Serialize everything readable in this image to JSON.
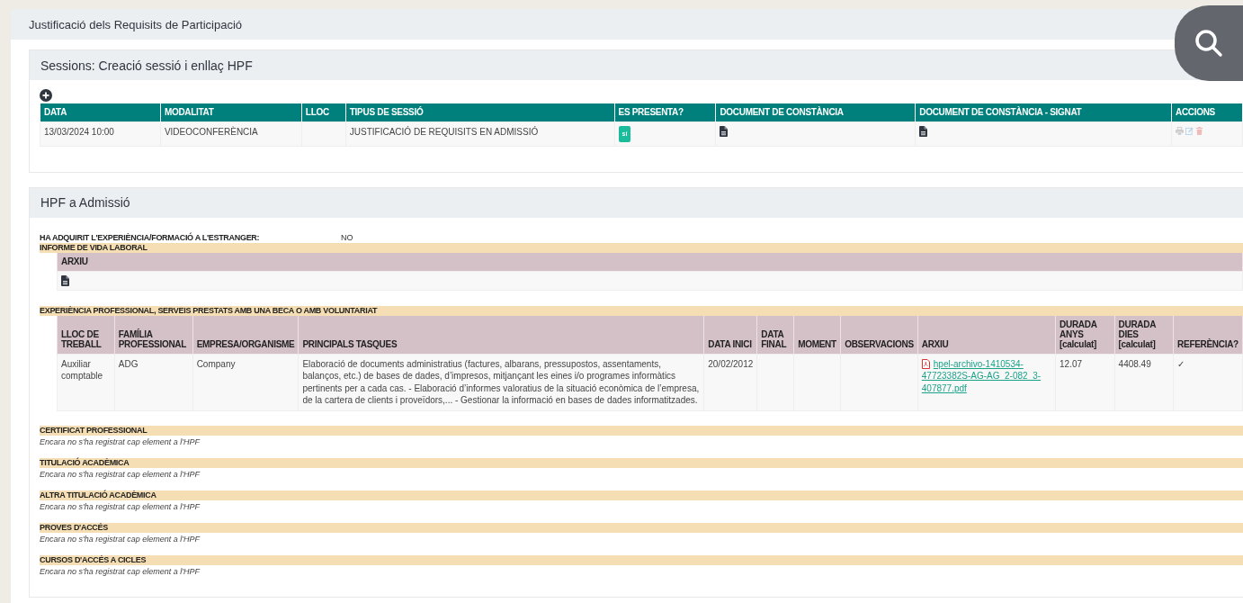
{
  "page_title": "Justificació dels Requisits de Participació",
  "sessions": {
    "title": "Sessions: Creació sessió i enllaç HPF",
    "columns": [
      "DATA",
      "MODALITAT",
      "LLOC",
      "TIPUS DE SESSIÓ",
      "ES PRESENTA?",
      "DOCUMENT DE CONSTÀNCIA",
      "DOCUMENT DE CONSTÀNCIA - SIGNAT",
      "ACCIONS"
    ],
    "rows": [
      {
        "cells": [
          {
            "kind": "text",
            "text": "13/03/2024 10:00"
          },
          {
            "kind": "text",
            "text": "VIDEOCONFERÈNCIA"
          },
          {
            "kind": "empty"
          },
          {
            "kind": "text",
            "text": "JUSTIFICACIÓ DE REQUISITS EN ADMISSIÓ"
          },
          {
            "kind": "badge",
            "text": "sí"
          },
          {
            "kind": "document"
          },
          {
            "kind": "document"
          },
          {
            "kind": "actions",
            "disabled": true
          }
        ]
      }
    ]
  },
  "hpf": {
    "title": "HPF a Admissió",
    "fields": [
      {
        "label": "HA ADQUIRIT L'EXPERIÈNCIA/FORMACIÓ A L'ESTRANGER:",
        "value": "NO"
      }
    ],
    "sections": [
      {
        "kind": "files",
        "title": "INFORME DE VIDA LABORAL",
        "columns": [
          "ARXIU"
        ],
        "rows": [
          {
            "cells": [
              {
                "kind": "document"
              }
            ]
          }
        ]
      },
      {
        "kind": "table",
        "title": "EXPERIÈNCIA PROFESSIONAL, SERVEIS PRESTATS AMB UNA BECA O AMB VOLUNTARIAT",
        "columns": [
          "LLOC DE TREBALL",
          "FAMÍLIA PROFESSIONAL",
          "EMPRESA/ORGANISME",
          "PRINCIPALS TASQUES",
          "DATA INICI",
          "DATA FINAL",
          "MOMENT",
          "OBSERVACIONS",
          "ARXIU",
          "DURADA ANYS [calculat]",
          "DURADA DIES [calculat]",
          "REFERÈNCIA?"
        ],
        "rows": [
          {
            "cells": [
              {
                "kind": "text",
                "text": "Auxiliar comptable"
              },
              {
                "kind": "text",
                "text": "ADG"
              },
              {
                "kind": "text",
                "text": "Company"
              },
              {
                "kind": "text",
                "text": "Elaboració de documents administratius (factures, albarans, pressupostos, assentaments, balanços, etc.) de bases de dades, d’impresos, mitjançant les eines i/o programes informàtics pertinents per a cada cas. - Elaboració d’informes valoratius de la situació econòmica de l’empresa, de la cartera de clients i proveïdors,... - Gestionar la informació en bases de dades informatitzades."
              },
              {
                "kind": "text",
                "text": "20/02/2012"
              },
              {
                "kind": "empty"
              },
              {
                "kind": "empty"
              },
              {
                "kind": "empty"
              },
              {
                "kind": "file",
                "text": "hpel-archivo-1410534-47723382S-AG-AG_2-082_3-407877.pdf"
              },
              {
                "kind": "text",
                "text": "12.07"
              },
              {
                "kind": "text",
                "text": "4408.49"
              },
              {
                "kind": "text",
                "text": "✓"
              }
            ]
          }
        ]
      },
      {
        "kind": "message",
        "title": "CERTIFICAT PROFESSIONAL",
        "message": "Encara no s'ha registrat cap element a l'HPF"
      },
      {
        "kind": "message",
        "title": "TITULACIÓ ACADÈMICA",
        "message": "Encara no s'ha registrat cap element a l'HPF"
      },
      {
        "kind": "message",
        "title": "ALTRA TITULACIÓ ACADÈMICA",
        "message": "Encara no s'ha registrat cap element a l'HPF"
      },
      {
        "kind": "message",
        "title": "PROVES D'ACCÉS",
        "message": "Encara no s'ha registrat cap element a l'HPF"
      },
      {
        "kind": "message",
        "title": "CURSOS D'ACCÉS A CICLES",
        "message": "Encara no s'ha registrat cap element a l'HPF"
      }
    ]
  }
}
